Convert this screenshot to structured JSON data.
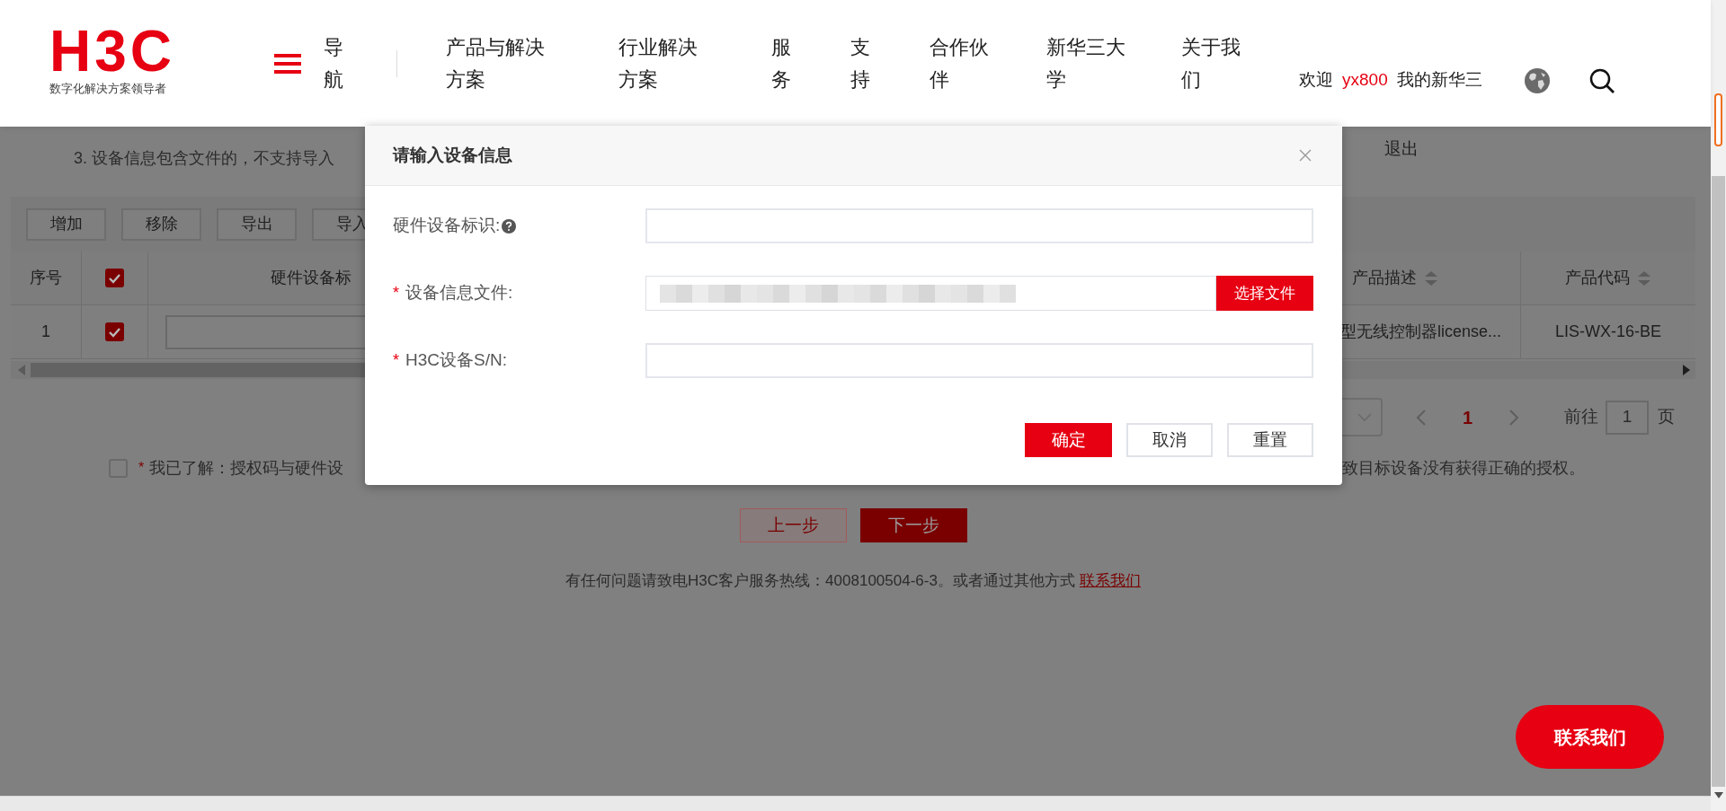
{
  "header": {
    "logo": "H3C",
    "tagline": "数字化解决方案领导者",
    "nav_toggle": "导航",
    "nav_items": [
      "产品与解决方案",
      "行业解决方案",
      "服务",
      "支持",
      "合作伙伴",
      "新华三大学",
      "关于我们"
    ],
    "welcome": "欢迎",
    "username": "yx800",
    "my_account": "我的新华三"
  },
  "page": {
    "instructions": [
      "3. 设备信息包含文件的，不支持导入"
    ],
    "logout": "退出",
    "toolbar": [
      "增加",
      "移除",
      "导出",
      "导入"
    ],
    "table": {
      "columns": [
        {
          "kind": "text",
          "label": "序号"
        },
        {
          "kind": "checkbox",
          "checked": true
        },
        {
          "kind": "text",
          "label": "硬件设备标"
        },
        {
          "kind": "sortable",
          "label": "产品描述"
        },
        {
          "kind": "sortable",
          "label": "产品代码"
        }
      ],
      "rows": [
        {
          "index": "1",
          "checked": true,
          "product_description": "型无线控制器license...",
          "product_code": "LIS-WX-16-BE"
        }
      ]
    },
    "pagination": {
      "page": "1",
      "goto_label": "前往",
      "goto_value": "1",
      "page_suffix": "页"
    },
    "agreement": {
      "checked": false,
      "required_mark": "*",
      "text_left": "我已了解：授权码与硬件设",
      "text_right": "致目标设备没有获得正确的授权。"
    },
    "steps": {
      "previous": "上一步",
      "next": "下一步"
    },
    "footer": {
      "text": "有任何问题请致电H3C客户服务热线：4008100504-6-3。或者通过其他方式",
      "link": "联系我们"
    }
  },
  "contact_button": "联系我们",
  "modal": {
    "title": "请输入设备信息",
    "fields": [
      {
        "kind": "text",
        "label": "硬件设备标识:",
        "help": true
      },
      {
        "kind": "file",
        "required_mark": "*",
        "label": "设备信息文件:",
        "button": "选择文件"
      },
      {
        "kind": "text",
        "required_mark": "*",
        "label": "H3C设备S/N:"
      }
    ],
    "buttons": [
      {
        "label": "确定",
        "primary": true
      },
      {
        "label": "取消",
        "primary": false
      },
      {
        "label": "重置",
        "primary": false
      }
    ]
  }
}
